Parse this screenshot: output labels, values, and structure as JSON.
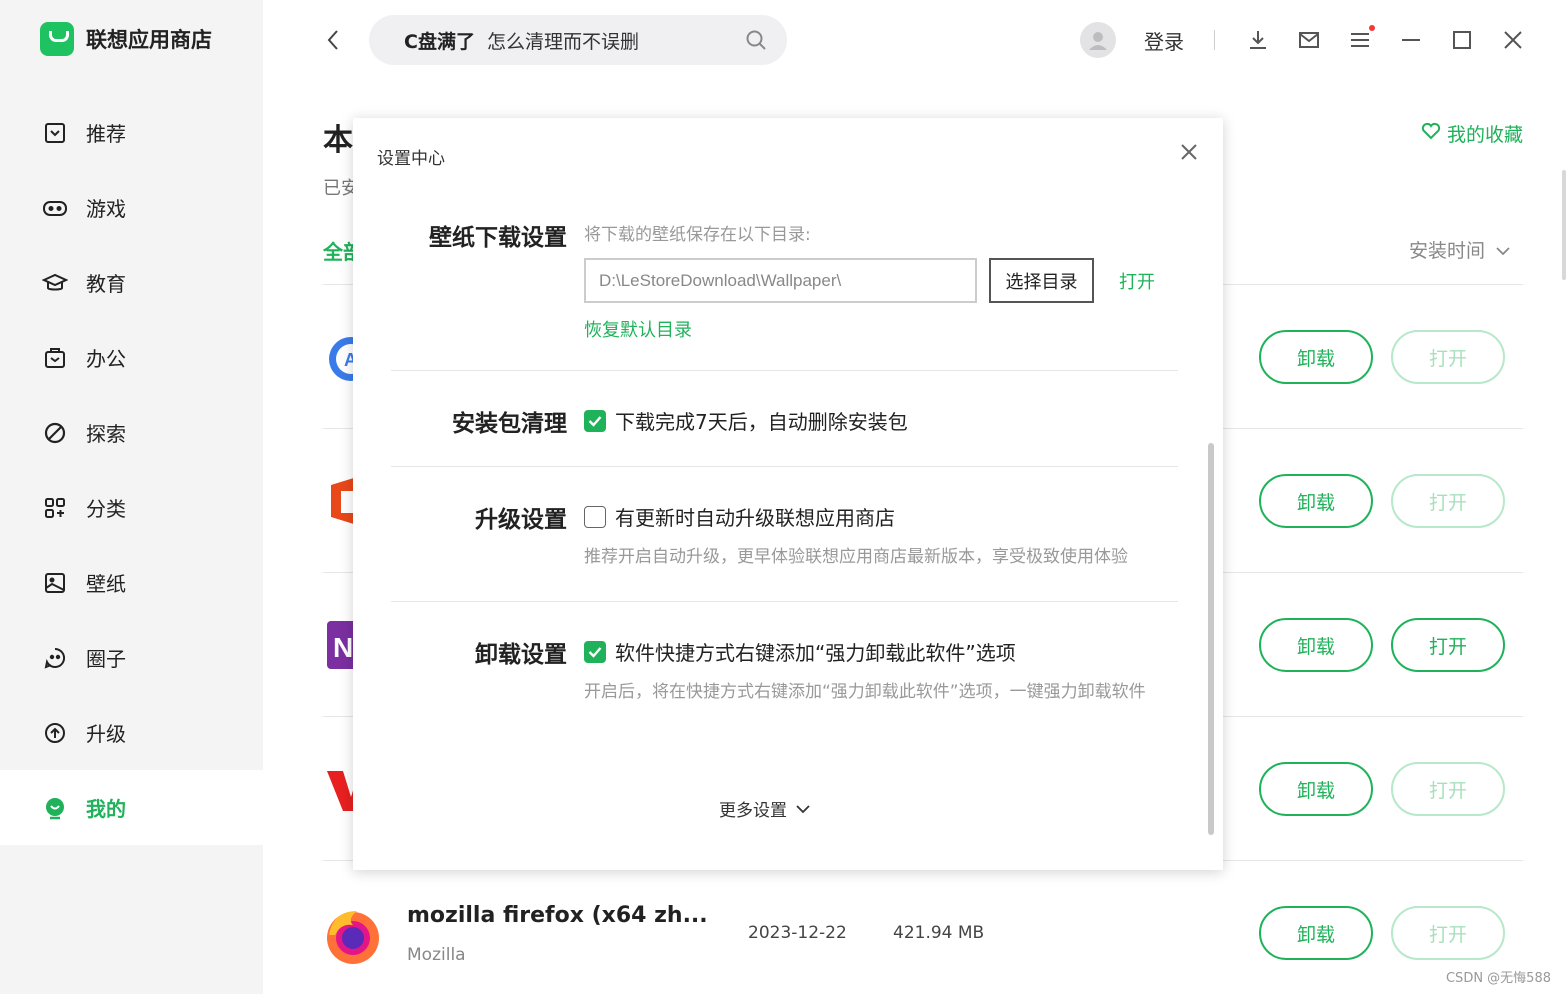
{
  "app": {
    "name": "联想应用商店"
  },
  "sidebar": {
    "items": [
      {
        "label": "推荐",
        "icon": "recommend-icon"
      },
      {
        "label": "游戏",
        "icon": "gamepad-icon"
      },
      {
        "label": "教育",
        "icon": "graduation-cap-icon"
      },
      {
        "label": "办公",
        "icon": "briefcase-icon"
      },
      {
        "label": "探索",
        "icon": "explore-icon"
      },
      {
        "label": "分类",
        "icon": "category-grid-icon"
      },
      {
        "label": "壁纸",
        "icon": "wallpaper-icon"
      },
      {
        "label": "圈子",
        "icon": "community-icon"
      },
      {
        "label": "升级",
        "icon": "upgrade-icon"
      },
      {
        "label": "我的",
        "icon": "user-smile-icon",
        "active": true
      }
    ]
  },
  "topbar": {
    "search_hot": "C盘满了",
    "search_rest": "怎么清理而不误删",
    "login": "登录"
  },
  "page": {
    "title": "本",
    "subtitle": "已安",
    "tab_all": "全部",
    "favorites": "我的收藏",
    "sort": "安装时间"
  },
  "apps": [
    {
      "name": "",
      "publisher": "",
      "date": "",
      "size": "",
      "uninstall": "卸载",
      "open": "打开",
      "open_enabled": false
    },
    {
      "name": "",
      "publisher": "",
      "date": "",
      "size": "",
      "uninstall": "卸载",
      "open": "打开",
      "open_enabled": false
    },
    {
      "name": "",
      "publisher": "",
      "date": "",
      "size": "",
      "uninstall": "卸载",
      "open": "打开",
      "open_enabled": true
    },
    {
      "name": "",
      "publisher": "",
      "date": "",
      "size": "",
      "uninstall": "卸载",
      "open": "打开",
      "open_enabled": false
    },
    {
      "name": "mozilla firefox (x64 zh...",
      "publisher": "Mozilla",
      "date": "2023-12-22",
      "size": "421.94 MB",
      "uninstall": "卸载",
      "open": "打开",
      "open_enabled": false
    }
  ],
  "modal": {
    "title": "设置中心",
    "wallpaper": {
      "label": "壁纸下载设置",
      "hint": "将下载的壁纸保存在以下目录:",
      "path": "D:\\LeStoreDownload\\Wallpaper\\",
      "choose": "选择目录",
      "open": "打开",
      "restore": "恢复默认目录"
    },
    "package_clean": {
      "label": "安装包清理",
      "option": "下载完成7天后，自动删除安装包",
      "checked": true
    },
    "upgrade": {
      "label": "升级设置",
      "option": "有更新时自动升级联想应用商店",
      "checked": false,
      "desc": "推荐开启自动升级，更早体验联想应用商店最新版本，享受极致使用体验"
    },
    "uninstall": {
      "label": "卸载设置",
      "option": "软件快捷方式右键添加“强力卸载此软件”选项",
      "checked": true,
      "desc": "开启后，将在快捷方式右键添加“强力卸载此软件”选项，一键强力卸载软件"
    },
    "more": "更多设置"
  },
  "watermark": "CSDN @无悔588",
  "colors": {
    "accent": "#1fb25a",
    "accent_light": "#b7e8c9"
  }
}
